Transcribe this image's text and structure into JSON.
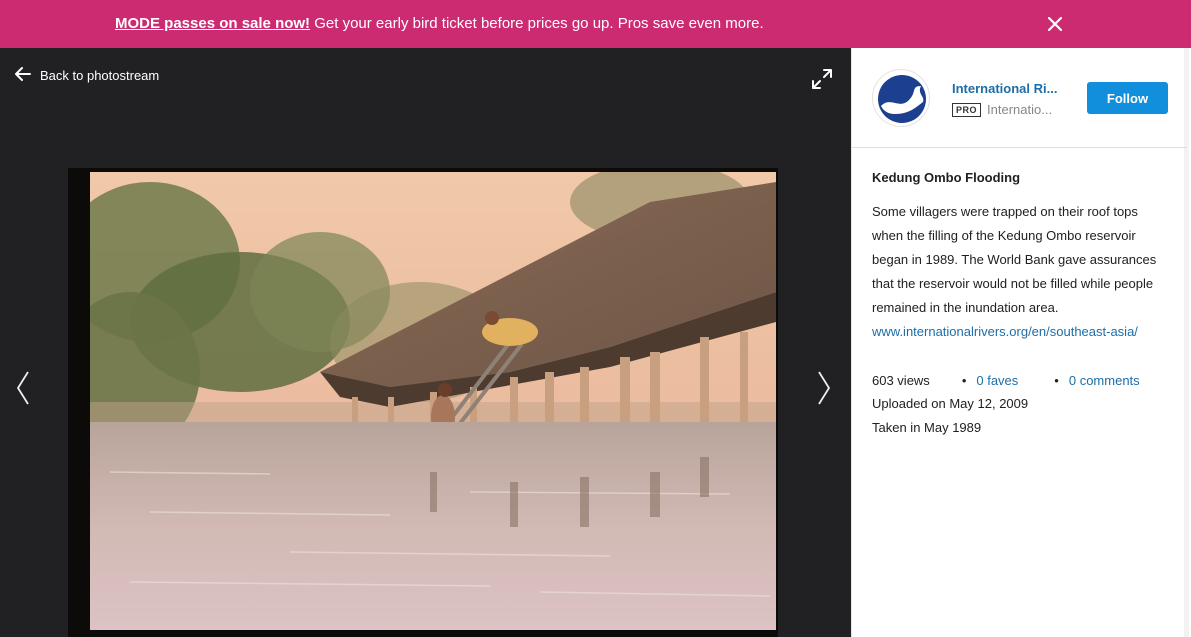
{
  "banner": {
    "highlight": "MODE passes on sale now!",
    "message": "Get your early bird ticket before prices go up. Pros save even more.",
    "close_icon": "close-icon",
    "bg_color": "#cc2a71"
  },
  "viewer": {
    "back_label": "Back to photostream",
    "back_icon": "arrow-left-icon",
    "expand_icon": "expand-icon",
    "prev_icon": "chevron-left-icon",
    "next_icon": "chevron-right-icon",
    "bg_color": "#212124"
  },
  "owner": {
    "name": "International Ri...",
    "badge": "PRO",
    "handle": "Internatio...",
    "follow_label": "Follow",
    "follow_color": "#128fdc"
  },
  "photo": {
    "title": "Kedung Ombo Flooding",
    "description": "Some villagers were trapped on their roof tops when the filling of the Kedung Ombo reservoir began in 1989. The World Bank gave assurances that the reservoir would not be filled while people remained in the inundation area.",
    "link": "www.internationalrivers.org/en/southeast-asia/"
  },
  "stats": {
    "views": "603 views",
    "faves": "0 faves",
    "comments": "0 comments",
    "uploaded": "Uploaded on May 12, 2009",
    "taken": "Taken in May 1989",
    "link_color": "#1c6ea9"
  }
}
